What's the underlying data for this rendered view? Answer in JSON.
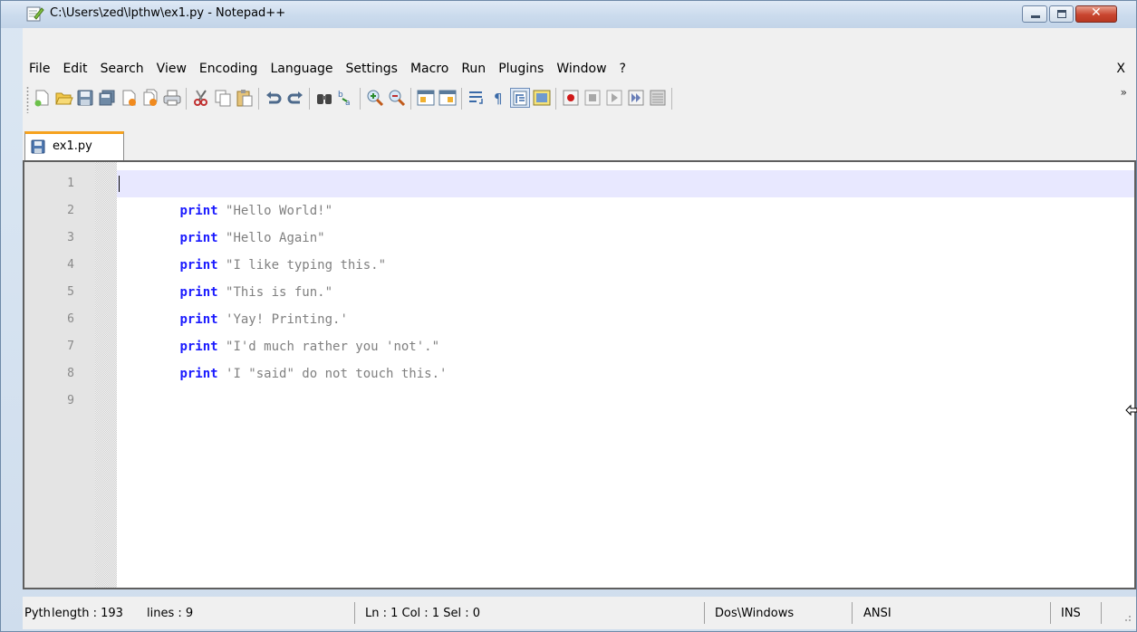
{
  "window": {
    "title": "C:\\Users\\zed\\lpthw\\ex1.py - Notepad++"
  },
  "menu": {
    "items": [
      "File",
      "Edit",
      "Search",
      "View",
      "Encoding",
      "Language",
      "Settings",
      "Macro",
      "Run",
      "Plugins",
      "Window",
      "?"
    ],
    "close_label": "X"
  },
  "toolbar": {
    "overflow": "»",
    "buttons": [
      "new-file-icon",
      "open-file-icon",
      "save-icon",
      "save-all-icon",
      "close-icon",
      "close-all-icon",
      "print-icon",
      "cut-icon",
      "copy-icon",
      "paste-icon",
      "undo-icon",
      "redo-icon",
      "find-icon",
      "replace-icon",
      "zoom-in-icon",
      "zoom-out-icon",
      "sync-vertical-icon",
      "sync-horizontal-icon",
      "word-wrap-icon",
      "show-all-chars-icon",
      "indent-guide-icon",
      "user-lang-icon",
      "macro-record-icon",
      "macro-stop-icon",
      "macro-play-icon",
      "macro-run-multiple-icon",
      "macro-save-icon"
    ]
  },
  "tabs": [
    {
      "label": "ex1.py",
      "active": true
    }
  ],
  "editor": {
    "lines": [
      {
        "num": "1",
        "kw": "print",
        "str": " \"Hello World!\""
      },
      {
        "num": "2",
        "kw": "print",
        "str": " \"Hello Again\""
      },
      {
        "num": "3",
        "kw": "print",
        "str": " \"I like typing this.\""
      },
      {
        "num": "4",
        "kw": "print",
        "str": " \"This is fun.\""
      },
      {
        "num": "5",
        "kw": "print",
        "str": " 'Yay! Printing.'"
      },
      {
        "num": "6",
        "kw": "print",
        "str": " \"I'd much rather you 'not'.\""
      },
      {
        "num": "7",
        "kw": "print",
        "str": " 'I \"said\" do not touch this.'"
      },
      {
        "num": "8",
        "kw": "",
        "str": ""
      },
      {
        "num": "9",
        "kw": "",
        "str": ""
      }
    ]
  },
  "status": {
    "lang": "Pyth",
    "length": "length : 193",
    "lines": "lines : 9",
    "position": "Ln : 1   Col : 1   Sel : 0",
    "eol": "Dos\\Windows",
    "encoding": "ANSI",
    "mode": "INS"
  },
  "colors": {
    "keyword": "#1a1aff",
    "string": "#808080",
    "current_line": "#e8e8ff",
    "tab_accent": "#f6a21e"
  }
}
